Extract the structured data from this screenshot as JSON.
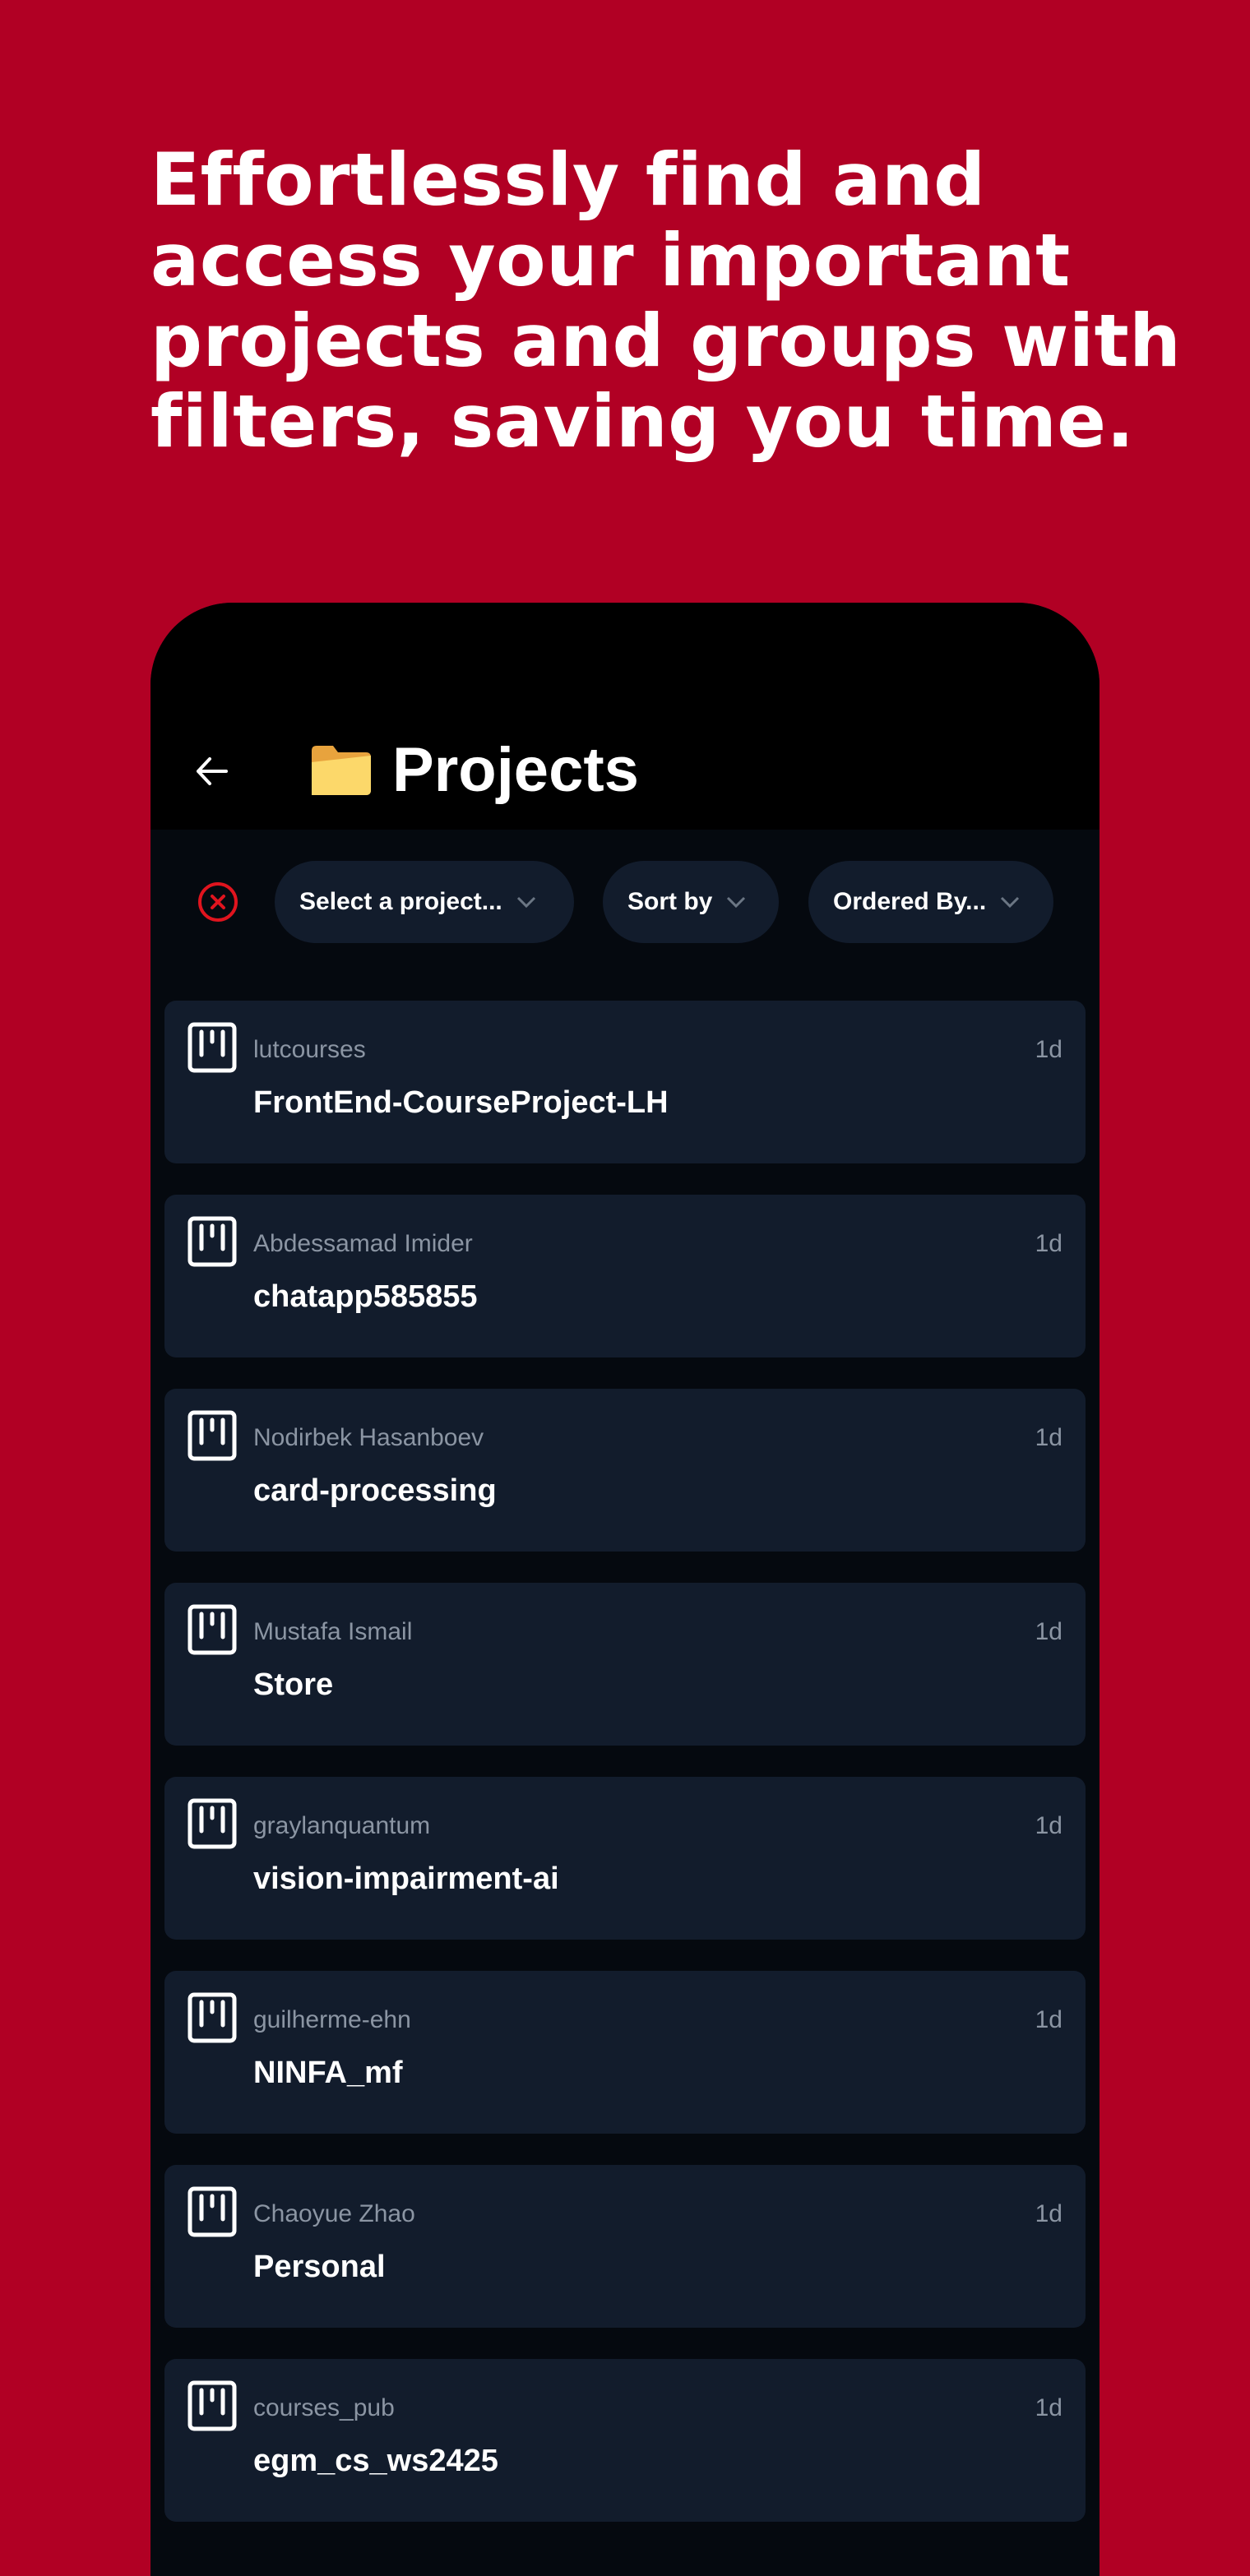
{
  "headline": "Effortlessly find and access your important projects and groups with filters, saving you time.",
  "app": {
    "title": "Projects",
    "title_icon": "folder-icon",
    "back_icon": "arrow-left-icon"
  },
  "filters": {
    "clear_icon": "close-circle-icon",
    "chips": [
      {
        "label": "Select a project...",
        "icon": "chevron-down-icon"
      },
      {
        "label": "Sort by",
        "icon": "chevron-down-icon"
      },
      {
        "label": "Ordered By...",
        "icon": "chevron-down-icon"
      }
    ]
  },
  "projects": [
    {
      "owner": "lutcourses",
      "name": "FrontEnd-CourseProject-LH",
      "time": "1d"
    },
    {
      "owner": "Abdessamad Imider",
      "name": "chatapp585855",
      "time": "1d"
    },
    {
      "owner": "Nodirbek Hasanboev",
      "name": "card-processing",
      "time": "1d"
    },
    {
      "owner": "Mustafa Ismail",
      "name": "Store",
      "time": "1d"
    },
    {
      "owner": "graylanquantum",
      "name": "vision-impairment-ai",
      "time": "1d"
    },
    {
      "owner": "guilherme-ehn",
      "name": "NINFA_mf",
      "time": "1d"
    },
    {
      "owner": "Chaoyue Zhao",
      "name": "Personal",
      "time": "1d"
    },
    {
      "owner": "courses_pub",
      "name": "egm_cs_ws2425",
      "time": "1d"
    }
  ],
  "colors": {
    "background": "#b10024",
    "card": "#121c2c",
    "clear": "#e0141e"
  }
}
